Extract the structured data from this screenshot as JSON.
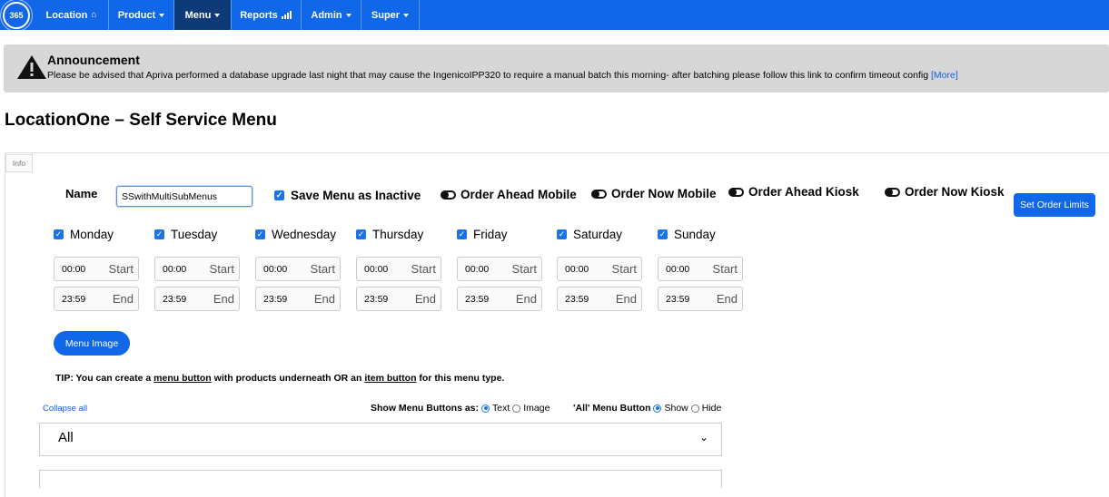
{
  "nav": {
    "logo_text": "365",
    "items": [
      {
        "label": "Location",
        "icon": "home-icon"
      },
      {
        "label": "Product"
      },
      {
        "label": "Menu"
      },
      {
        "label": "Reports",
        "icon": "bar-chart-icon"
      },
      {
        "label": "Admin"
      },
      {
        "label": "Super"
      }
    ]
  },
  "announcement": {
    "title": "Announcement",
    "text": "Please be advised that Apriva performed a database upgrade last night that may cause the IngenicoIPP320 to require a manual batch this morning- after batching please follow this link to confirm timeout config",
    "more_link": "[More]"
  },
  "page": {
    "title": "LocationOne – Self Service Menu"
  },
  "info_tab": "Info",
  "form": {
    "name_label": "Name",
    "name_value": "SSwithMultiSubMenus",
    "save_inactive_label": "Save Menu as Inactive",
    "toggles": [
      "Order Ahead Mobile",
      "Order Now Mobile",
      "Order Ahead Kiosk",
      "Order Now Kiosk"
    ],
    "set_limits_button": "Set Order Limits",
    "days": [
      {
        "name": "Monday",
        "start": "00:00",
        "end": "23:59"
      },
      {
        "name": "Tuesday",
        "start": "00:00",
        "end": "23:59"
      },
      {
        "name": "Wednesday",
        "start": "00:00",
        "end": "23:59"
      },
      {
        "name": "Thursday",
        "start": "00:00",
        "end": "23:59"
      },
      {
        "name": "Friday",
        "start": "00:00",
        "end": "23:59"
      },
      {
        "name": "Saturday",
        "start": "00:00",
        "end": "23:59"
      },
      {
        "name": "Sunday",
        "start": "00:00",
        "end": "23:59"
      }
    ],
    "start_label": "Start",
    "end_label": "End",
    "menu_image_button": "Menu Image",
    "tip": {
      "prefix": "TIP: You can create a ",
      "link1": "menu button",
      "middle": " with products underneath OR an ",
      "link2": "item button",
      "suffix": " for this menu type."
    },
    "collapse_all": "Collapse all",
    "show_buttons_label": "Show Menu Buttons as:",
    "show_options": [
      "Text",
      "Image"
    ],
    "all_button_label": "'All' Menu Button",
    "all_options": [
      "Show",
      "Hide"
    ],
    "accordion_first": "All"
  },
  "colors": {
    "brand": "#1067e8",
    "nav_active": "#0e3a78"
  }
}
